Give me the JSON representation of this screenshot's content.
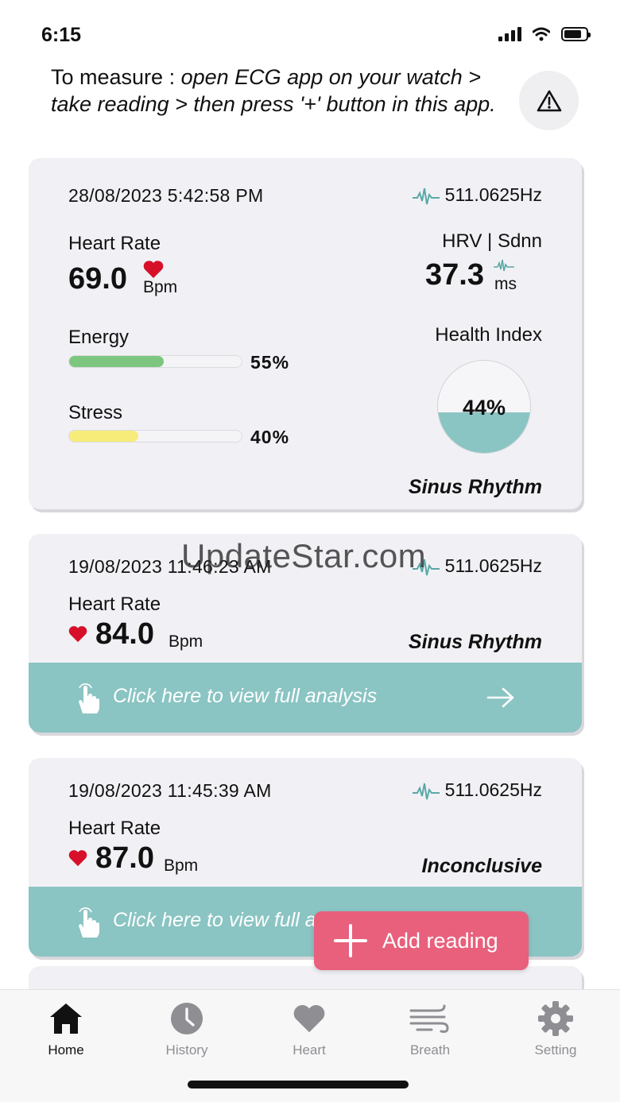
{
  "status_bar": {
    "time": "6:15"
  },
  "instruction": {
    "bold_part": "To measure :",
    "italic_part": "open ECG app on your watch > take reading > then press '+' button in this app."
  },
  "main_card": {
    "datetime": "28/08/2023  5:42:58 PM",
    "frequency": "511.0625Hz",
    "heart_rate_label": "Heart Rate",
    "heart_rate_value": "69.0",
    "heart_rate_unit": "Bpm",
    "hrv_label": "HRV | Sdnn",
    "hrv_value": "37.3",
    "hrv_unit": "ms",
    "energy_label": "Energy",
    "energy_value": "55%",
    "energy_fraction": 0.55,
    "stress_label": "Stress",
    "stress_value": "40%",
    "stress_fraction": 0.4,
    "health_index_label": "Health Index",
    "health_index_value": "44%",
    "health_index_fraction": 0.44,
    "rhythm": "Sinus Rhythm"
  },
  "readings": [
    {
      "datetime": "19/08/2023  11:46:23 AM",
      "frequency": "511.0625Hz",
      "heart_rate_label": "Heart Rate",
      "heart_rate_value": "84.0",
      "heart_rate_unit": "Bpm",
      "rhythm": "Sinus Rhythm",
      "analysis_label": "Click here to view full analysis"
    },
    {
      "datetime": "19/08/2023  11:45:39 AM",
      "frequency": "511.0625Hz",
      "heart_rate_label": "Heart Rate",
      "heart_rate_value": "87.0",
      "heart_rate_unit": "Bpm",
      "rhythm": "Inconclusive",
      "analysis_label": "Click here to view full analysis"
    }
  ],
  "fab": {
    "label": "Add reading"
  },
  "watermark": "UpdateStar.com",
  "tabs": [
    {
      "label": "Home",
      "icon": "home-icon",
      "active": true
    },
    {
      "label": "History",
      "icon": "clock-icon",
      "active": false
    },
    {
      "label": "Heart",
      "icon": "heart-icon",
      "active": false
    },
    {
      "label": "Breath",
      "icon": "wind-icon",
      "active": false
    },
    {
      "label": "Setting",
      "icon": "gear-icon",
      "active": false
    }
  ],
  "colors": {
    "accent_teal": "#8ac4c3",
    "energy_green": "#7dc67f",
    "stress_yellow": "#f7ec7a",
    "heart_red": "#d7102a",
    "fab_pink": "#e8607c"
  }
}
